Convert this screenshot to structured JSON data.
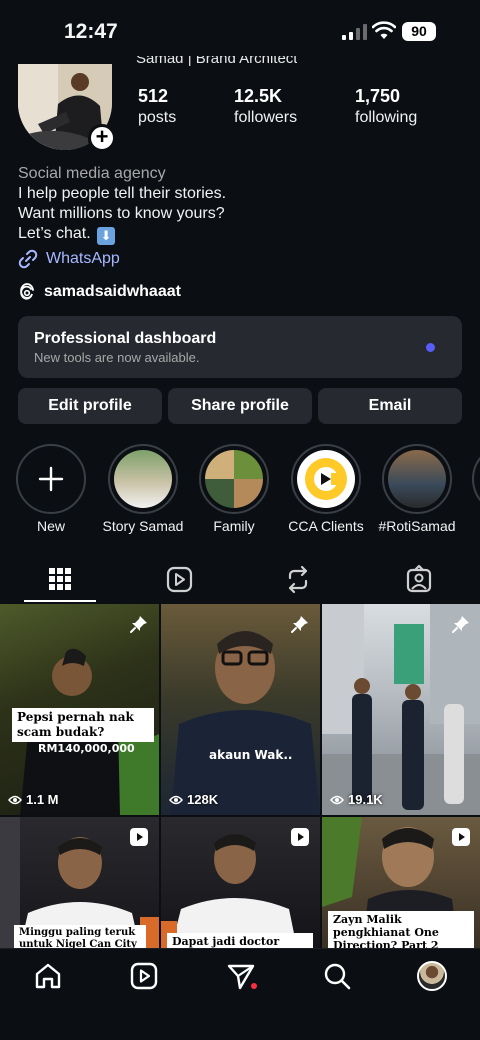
{
  "status_bar": {
    "time": "12:47",
    "battery": "90"
  },
  "profile": {
    "name_cut": "Samad | Brand Architect",
    "stats": [
      {
        "value": "512",
        "label": "posts"
      },
      {
        "value": "12.5K",
        "label": "followers"
      },
      {
        "value": "1,750",
        "label": "following"
      }
    ],
    "category": "Social media agency",
    "bio_lines": [
      "I help people tell their stories.",
      "Want millions to know yours?",
      "Let’s chat."
    ],
    "bio_emoji": "⬇",
    "link_label": "WhatsApp",
    "threads_handle": "samadsaidwhaaat"
  },
  "dashboard": {
    "title": "Professional dashboard",
    "subtitle": "New tools are now available."
  },
  "buttons": {
    "edit": "Edit profile",
    "share": "Share profile",
    "email": "Email"
  },
  "highlights": [
    {
      "label": "New",
      "icon": "plus-icon"
    },
    {
      "label": "Story Samad"
    },
    {
      "label": "Family"
    },
    {
      "label": "CCA Clients"
    },
    {
      "label": "#RotiSamad"
    }
  ],
  "tabs": [
    "grid-icon",
    "reels-icon",
    "reposts-icon",
    "tagged-icon"
  ],
  "grid": [
    {
      "caption": "Pepsi pernah nak scam budak?",
      "overlay": "RM140,000,000",
      "views": "1.1 M",
      "badge": "pin-icon"
    },
    {
      "caption": "akaun Wak..",
      "views": "128K",
      "badge": "pin-icon"
    },
    {
      "caption": "",
      "views": "19.1K",
      "badge": "pin-icon"
    },
    {
      "caption": "Minggu paling teruk untuk Nigel Can City",
      "badge": "reel-icon"
    },
    {
      "caption": "Dapat jadi doctor sebab",
      "badge": "reel-icon"
    },
    {
      "caption": "Zayn Malik pengkhianat One Direction? Part 2",
      "badge": "reel-icon"
    }
  ],
  "nav": [
    "home-icon",
    "reels-icon",
    "messages-icon",
    "search-icon",
    "profile-avatar"
  ],
  "colors": {
    "background": "#0b0f14",
    "card": "#262a30",
    "link": "#a7b8ff",
    "accent_dot": "#5a5cf7",
    "notification": "#ff2d44"
  }
}
